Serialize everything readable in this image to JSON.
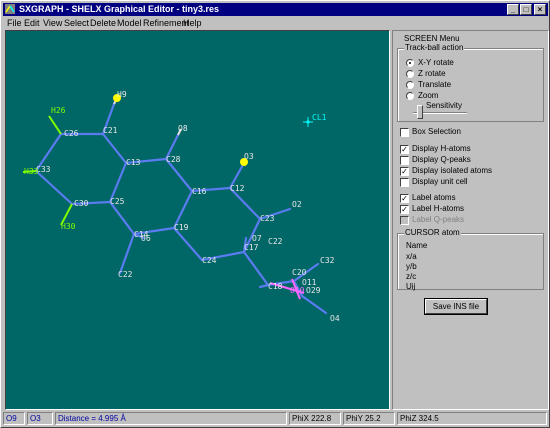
{
  "window": {
    "title": "SXGRAPH - SHELX Graphical Editor - tiny3.res",
    "minimize": "_",
    "maximize": "□",
    "close": "×"
  },
  "menu": [
    "File",
    "Edit",
    "View",
    "Select",
    "Delete",
    "Model",
    "Refinement",
    "Help"
  ],
  "panel": {
    "title": "SCREEN Menu",
    "trackball": {
      "title": "Track-ball action",
      "options": [
        "X-Y rotate",
        "Z rotate",
        "Translate",
        "Zoom"
      ],
      "selected": 0,
      "sensitivity_label": "Sensitivity",
      "sensitivity_level": 0.1
    },
    "box_selection": {
      "label": "Box Selection",
      "checked": false
    },
    "display": [
      {
        "label": "Display H-atoms",
        "checked": true
      },
      {
        "label": "Display Q-peaks",
        "checked": false
      },
      {
        "label": "Display isolated atoms",
        "checked": true
      },
      {
        "label": "Display unit cell",
        "checked": false
      }
    ],
    "labels": [
      {
        "label": "Label atoms",
        "checked": true,
        "enabled": true
      },
      {
        "label": "Label H-atoms",
        "checked": true,
        "enabled": true
      },
      {
        "label": "Label Q-peaks",
        "checked": false,
        "enabled": false
      }
    ],
    "cursor": {
      "title": "CURSOR atom",
      "fields": [
        "Name",
        "x/a",
        "y/b",
        "z/c",
        "Uij"
      ]
    },
    "save_button": "Save INS file"
  },
  "atoms": {
    "labels": [
      "H26",
      "H9",
      "C26",
      "C21",
      "O8",
      "O3",
      "C13",
      "C28",
      "C33",
      "H33",
      "C12",
      "C16",
      "O2",
      "C30",
      "C25",
      "H30",
      "O6",
      "C14",
      "C19",
      "C23",
      "O7",
      "C22",
      "C17",
      "C24",
      "C32",
      "C20",
      "C18",
      "O11",
      "O10",
      "O29",
      "O4",
      "C22",
      "CL1"
    ]
  },
  "colors": {
    "background": "#006666",
    "bond": "#5a7cf0",
    "hydrogen": "#7fff00",
    "oxygen": "#ffff00",
    "chlorine": "#00ffff",
    "highlight": "#ff66ff"
  },
  "status": {
    "atom1": "O9",
    "atom2": "O3",
    "distance": "Distance = 4.995 Å",
    "phix": "PhiX 222.8",
    "phiy": "PhiY 25.2",
    "phiz": "PhiZ 324.5"
  }
}
